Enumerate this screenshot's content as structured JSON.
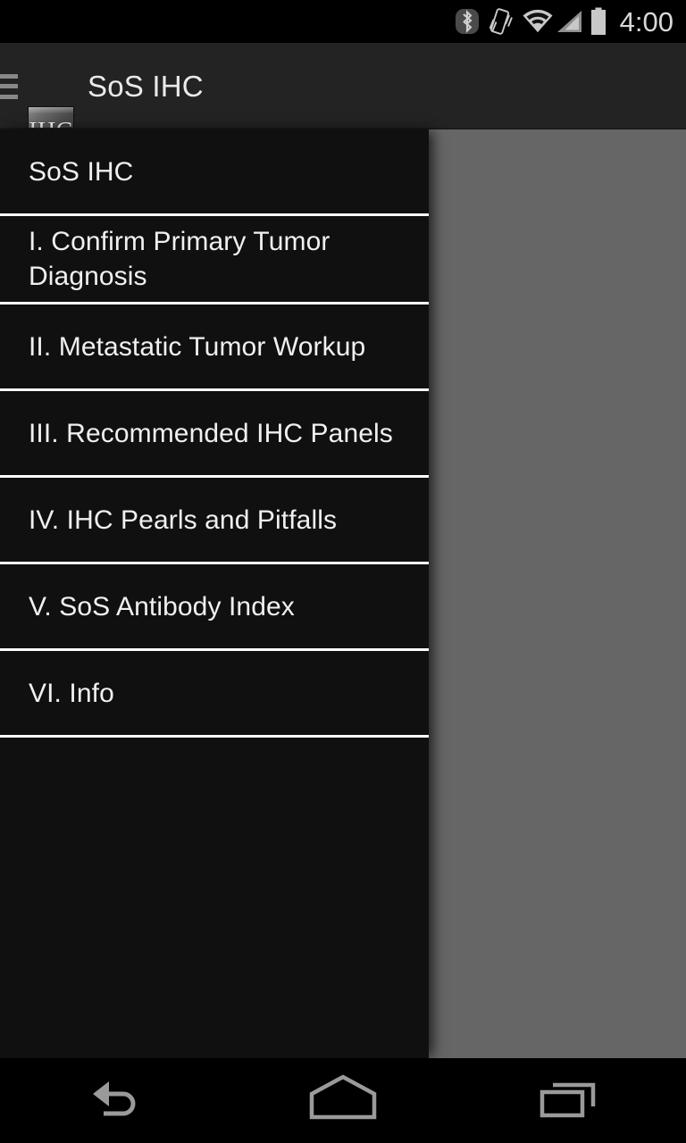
{
  "status_bar": {
    "time": "4:00",
    "icons": [
      {
        "name": "bluetooth-icon",
        "label": "Bluetooth"
      },
      {
        "name": "vibrate-icon",
        "label": "Vibrate"
      },
      {
        "name": "wifi-icon",
        "label": "Wi-Fi"
      },
      {
        "name": "cellular-signal-icon",
        "label": "Cellular signal"
      },
      {
        "name": "battery-icon",
        "label": "Battery"
      }
    ],
    "background_color": "#000000",
    "icon_color": "#c8c8c8"
  },
  "action_bar": {
    "title": "SoS IHC",
    "app_icon_text": "IHC",
    "menu_icon": "hamburger-menu-icon",
    "background_color": "#232323",
    "title_color": "#eaeaea"
  },
  "drawer": {
    "background_color": "#101010",
    "divider_color": "#ffffff",
    "text_color": "#f0f0f0",
    "items": [
      {
        "label": "SoS IHC",
        "name": "drawer-item-sos-ihc"
      },
      {
        "label": "I. Confirm Primary Tumor Diagnosis",
        "name": "drawer-item-confirm-primary-tumor-diagnosis"
      },
      {
        "label": "II. Metastatic Tumor Workup",
        "name": "drawer-item-metastatic-tumor-workup"
      },
      {
        "label": "III. Recommended IHC Panels",
        "name": "drawer-item-recommended-ihc-panels"
      },
      {
        "label": "IV. IHC Pearls and Pitfalls",
        "name": "drawer-item-ihc-pearls-and-pitfalls"
      },
      {
        "label": "V. SoS Antibody Index",
        "name": "drawer-item-sos-antibody-index"
      },
      {
        "label": "VI. Info",
        "name": "drawer-item-info"
      }
    ]
  },
  "content": {
    "scrim_color": "#666666"
  },
  "system_nav": {
    "background_color": "#000000",
    "icon_color": "#9a9a9a",
    "buttons": [
      {
        "name": "back-button",
        "icon": "back-arrow-icon",
        "label": "Back"
      },
      {
        "name": "home-button",
        "icon": "home-icon",
        "label": "Home"
      },
      {
        "name": "recents-button",
        "icon": "recents-icon",
        "label": "Recent apps"
      }
    ]
  }
}
